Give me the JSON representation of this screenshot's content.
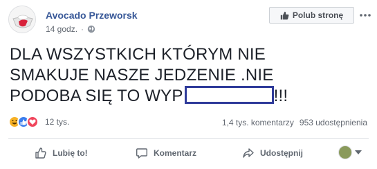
{
  "post": {
    "author": "Avocado Przeworsk",
    "time": "14 godz.",
    "meta_separator": "·",
    "privacy_icon": "globe-icon",
    "like_page_label": "Polub stronę",
    "text_line1": "DLA WSZYSTKICH KTÓRYM NIE",
    "text_line2": "SMAKUJE NASZE JEDZENIE .NIE",
    "text_line3_start": "PODOBA SIĘ TO WYP",
    "text_line3_end": "!!!"
  },
  "reactions": {
    "icons": [
      "haha-reaction-icon",
      "like-reaction-icon",
      "love-reaction-icon"
    ],
    "count": "12 tys.",
    "comments": "1,4 tys. komentarzy",
    "shares": "953 udostępnienia"
  },
  "actions": {
    "like": "Lubię to!",
    "comment": "Komentarz",
    "share": "Udostępnij"
  },
  "colors": {
    "author_link": "#385898",
    "redaction_box": "#2f3b9a",
    "like_blue": "#3b7ded",
    "love_red": "#f0445b",
    "haha_yellow": "#f7b125"
  }
}
